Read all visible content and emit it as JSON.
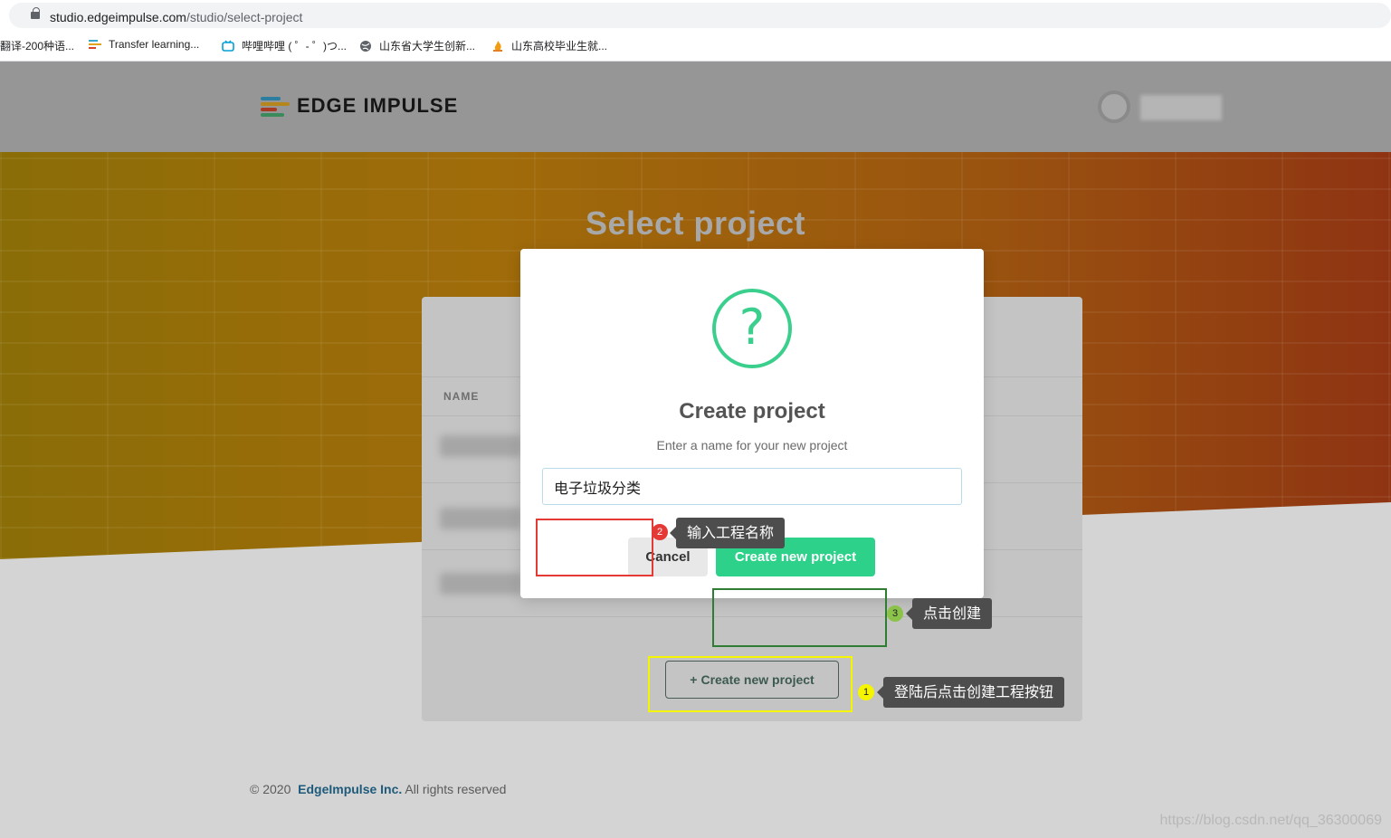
{
  "browser": {
    "url_host": "studio.edgeimpulse.com",
    "url_path": "/studio/select-project",
    "bookmarks": [
      {
        "label": "翻译-200种语...",
        "icon": "none"
      },
      {
        "label": "Transfer learning...",
        "icon": "edge-impulse-icon"
      },
      {
        "label": "哔哩哔哩 ( ゜- ゜)つ...",
        "icon": "bilibili-icon"
      },
      {
        "label": "山东省大学生创新...",
        "icon": "globe-icon"
      },
      {
        "label": "山东高校毕业生就...",
        "icon": "flame-icon"
      }
    ]
  },
  "header": {
    "brand": "EDGE IMPULSE"
  },
  "page": {
    "title": "Select project",
    "column_name": "NAME",
    "create_button": "Create new project"
  },
  "modal": {
    "title": "Create project",
    "subtitle": "Enter a name for your new project",
    "input_value": "电子垃圾分类",
    "cancel": "Cancel",
    "create": "Create new project"
  },
  "annotations": [
    {
      "num": "1",
      "text": "登陆后点击创建工程按钮",
      "color": "#f5f500"
    },
    {
      "num": "2",
      "text": "输入工程名称",
      "color": "#e53935"
    },
    {
      "num": "3",
      "text": "点击创建",
      "color": "#8bc34a"
    }
  ],
  "footer": {
    "year": "© 2020",
    "company": "EdgeImpulse Inc.",
    "rights": "All rights reserved"
  },
  "watermark": "https://blog.csdn.net/qq_36300069",
  "colors": {
    "accent": "#2ed18a",
    "hero_orange": "#a06c0a",
    "yellow_box": "#f5f500",
    "green_box": "#2e7d32",
    "red_box": "#e53935"
  }
}
